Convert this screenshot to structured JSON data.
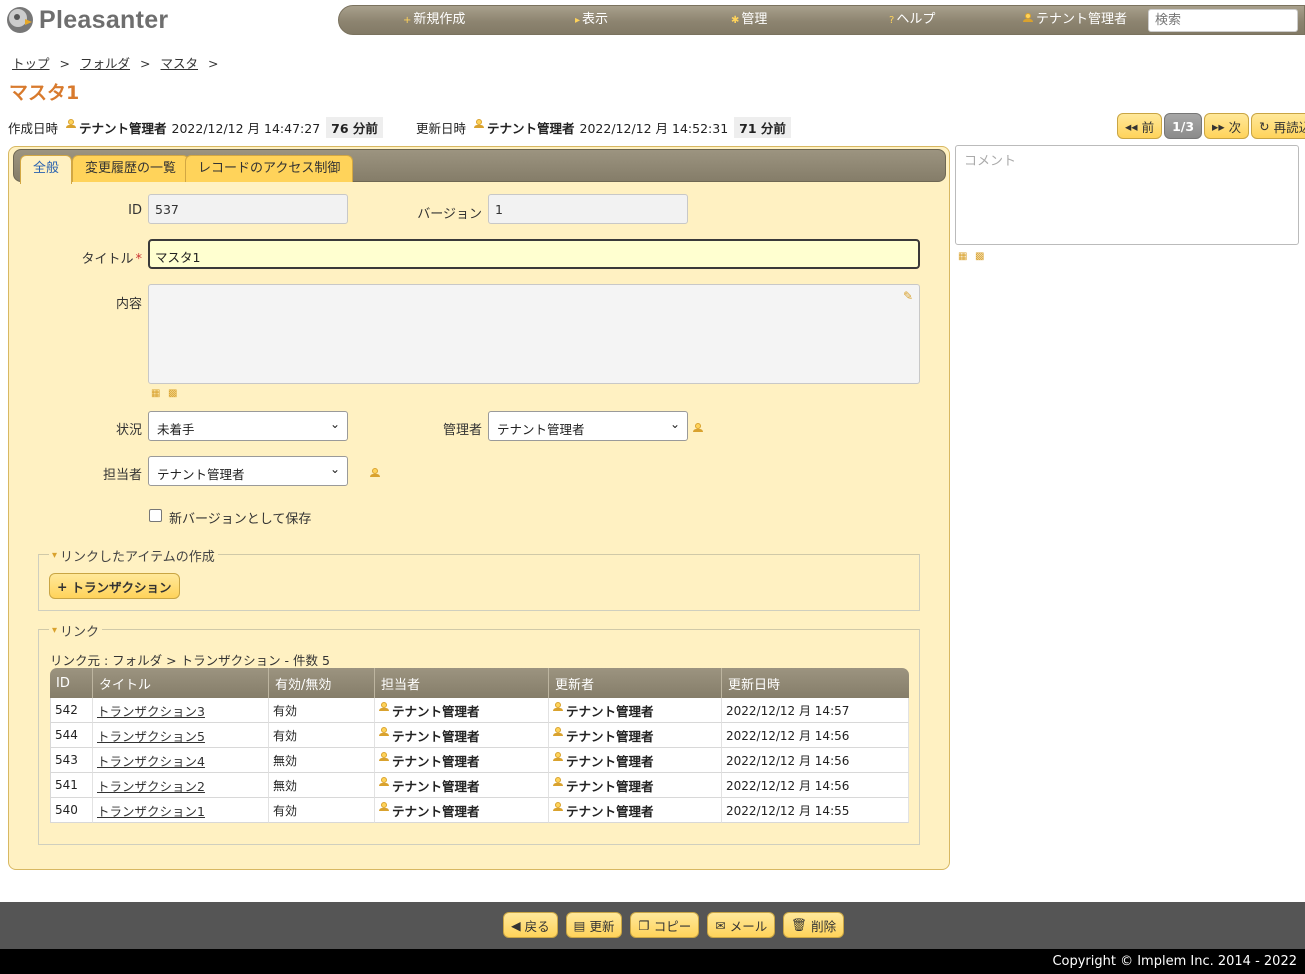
{
  "app": {
    "logo_text": "Pleasanter"
  },
  "nav": {
    "items": [
      {
        "icon": "plus-icon",
        "label": "新規作成"
      },
      {
        "icon": "triangle-right-icon",
        "label": "表示"
      },
      {
        "icon": "gear-icon",
        "label": "管理"
      },
      {
        "icon": "help-icon",
        "label": "ヘルプ"
      },
      {
        "icon": "user-icon",
        "label": "テナント管理者"
      }
    ],
    "search_placeholder": "検索"
  },
  "breadcrumb": [
    "トップ",
    "フォルダ",
    "マスタ"
  ],
  "page_title": "マスタ1",
  "record_info": {
    "created_label": "作成日時",
    "created_user": "テナント管理者",
    "created_at": "2022/12/12 月 14:47:27",
    "created_elapsed": "76 分前",
    "updated_label": "更新日時",
    "updated_user": "テナント管理者",
    "updated_at": "2022/12/12 月 14:52:31",
    "updated_elapsed": "71 分前"
  },
  "pager": {
    "prev": "前",
    "position": "1/3",
    "next": "次",
    "reload": "再読込"
  },
  "tabs": [
    "全般",
    "変更履歴の一覧",
    "レコードのアクセス制御"
  ],
  "form": {
    "id_label": "ID",
    "id_value": "537",
    "version_label": "バージョン",
    "version_value": "1",
    "title_label": "タイトル",
    "title_required": "*",
    "title_value": "マスタ1",
    "body_label": "内容",
    "status_label": "状況",
    "status_value": "未着手",
    "manager_label": "管理者",
    "manager_value": "テナント管理者",
    "owner_label": "担当者",
    "owner_value": "テナント管理者",
    "new_version_label": "新バージョンとして保存"
  },
  "linked_create": {
    "legend": "リンクしたアイテムの作成",
    "button": "トランザクション"
  },
  "links": {
    "legend": "リンク",
    "caption": "リンク元 : フォルダ > トランザクション - 件数 5",
    "columns": [
      "ID",
      "タイトル",
      "有効/無効",
      "担当者",
      "更新者",
      "更新日時"
    ],
    "rows": [
      {
        "id": "542",
        "title": "トランザクション3",
        "enabled": "有効",
        "owner": "テナント管理者",
        "updater": "テナント管理者",
        "updated": "2022/12/12 月 14:57"
      },
      {
        "id": "544",
        "title": "トランザクション5",
        "enabled": "有効",
        "owner": "テナント管理者",
        "updater": "テナント管理者",
        "updated": "2022/12/12 月 14:56"
      },
      {
        "id": "543",
        "title": "トランザクション4",
        "enabled": "無効",
        "owner": "テナント管理者",
        "updater": "テナント管理者",
        "updated": "2022/12/12 月 14:56"
      },
      {
        "id": "541",
        "title": "トランザクション2",
        "enabled": "無効",
        "owner": "テナント管理者",
        "updater": "テナント管理者",
        "updated": "2022/12/12 月 14:56"
      },
      {
        "id": "540",
        "title": "トランザクション1",
        "enabled": "有効",
        "owner": "テナント管理者",
        "updater": "テナント管理者",
        "updated": "2022/12/12 月 14:55"
      }
    ]
  },
  "comment": {
    "placeholder": "コメント"
  },
  "footer": {
    "back": "戻る",
    "update": "更新",
    "copy": "コピー",
    "mail": "メール",
    "delete": "削除"
  },
  "copyright": "Copyright © Implem Inc. 2014 - 2022",
  "colors": {
    "accent": "#ffd35a",
    "panel": "#fff1c2",
    "title": "#d87a2d",
    "header": "#8d8470"
  }
}
